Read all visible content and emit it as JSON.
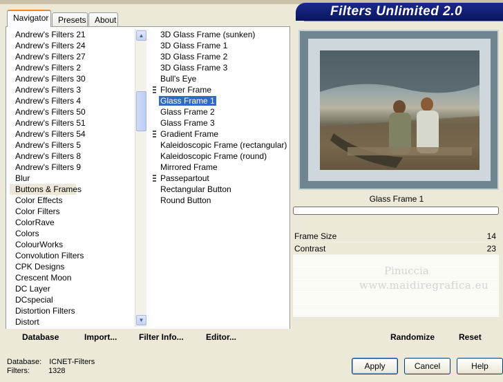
{
  "banner": {
    "title": "Filters Unlimited 2.0"
  },
  "tabs": [
    {
      "label": "Navigator",
      "active": true
    },
    {
      "label": "Presets",
      "active": false
    },
    {
      "label": "About",
      "active": false
    }
  ],
  "categories": {
    "items": [
      "Andrew's Filters 21",
      "Andrew's Filters 24",
      "Andrew's Filters 27",
      "Andrew's Filters 2",
      "Andrew's Filters 30",
      "Andrew's Filters 3",
      "Andrew's Filters 4",
      "Andrew's Filters 50",
      "Andrew's Filters 51",
      "Andrew's Filters 54",
      "Andrew's Filters 5",
      "Andrew's Filters 8",
      "Andrew's Filters 9",
      "Blur",
      "Buttons & Frames",
      "Color Effects",
      "Color Filters",
      "ColorRave",
      "Colors",
      "ColourWorks",
      "Convolution Filters",
      "CPK Designs",
      "Crescent Moon",
      "DC Layer",
      "DCspecial",
      "Distortion Filters",
      "Distort"
    ],
    "selected": "Buttons & Frames"
  },
  "filters": {
    "items": [
      {
        "label": "3D Glass Frame (sunken)",
        "marker": false
      },
      {
        "label": "3D Glass Frame 1",
        "marker": false
      },
      {
        "label": "3D Glass Frame 2",
        "marker": false
      },
      {
        "label": "3D Glass Frame 3",
        "marker": false
      },
      {
        "label": "Bull's Eye",
        "marker": false
      },
      {
        "label": "Flower Frame",
        "marker": true
      },
      {
        "label": "Glass Frame 1",
        "marker": false
      },
      {
        "label": "Glass Frame 2",
        "marker": false
      },
      {
        "label": "Glass Frame 3",
        "marker": false
      },
      {
        "label": "Gradient Frame",
        "marker": true
      },
      {
        "label": "Kaleidoscopic Frame (rectangular)",
        "marker": false
      },
      {
        "label": "Kaleidoscopic Frame (round)",
        "marker": false
      },
      {
        "label": "Mirrored Frame",
        "marker": false
      },
      {
        "label": "Passepartout",
        "marker": true
      },
      {
        "label": "Rectangular Button",
        "marker": false
      },
      {
        "label": "Round Button",
        "marker": false
      }
    ],
    "selected": "Glass Frame 1"
  },
  "preview": {
    "filter_name": "Glass Frame 1",
    "progress": 0
  },
  "params": [
    {
      "label": "Frame Size",
      "value": "14"
    },
    {
      "label": "Contrast",
      "value": "23"
    }
  ],
  "watermark": {
    "line1": "Pinuccia",
    "line2": "www.maidiregrafica.eu"
  },
  "links": {
    "database": "Database",
    "import": "Import...",
    "filter_info": "Filter Info...",
    "editor": "Editor...",
    "randomize": "Randomize",
    "reset": "Reset"
  },
  "info": {
    "database_label": "Database:",
    "database_value": "ICNET-Filters",
    "filters_label": "Filters:",
    "filters_value": "1328"
  },
  "buttons": {
    "apply": "Apply",
    "cancel": "Cancel",
    "help": "Help"
  },
  "colors": {
    "banner": "#0a1560",
    "selection": "#316ac5",
    "dialog_bg": "#ece9d8"
  }
}
